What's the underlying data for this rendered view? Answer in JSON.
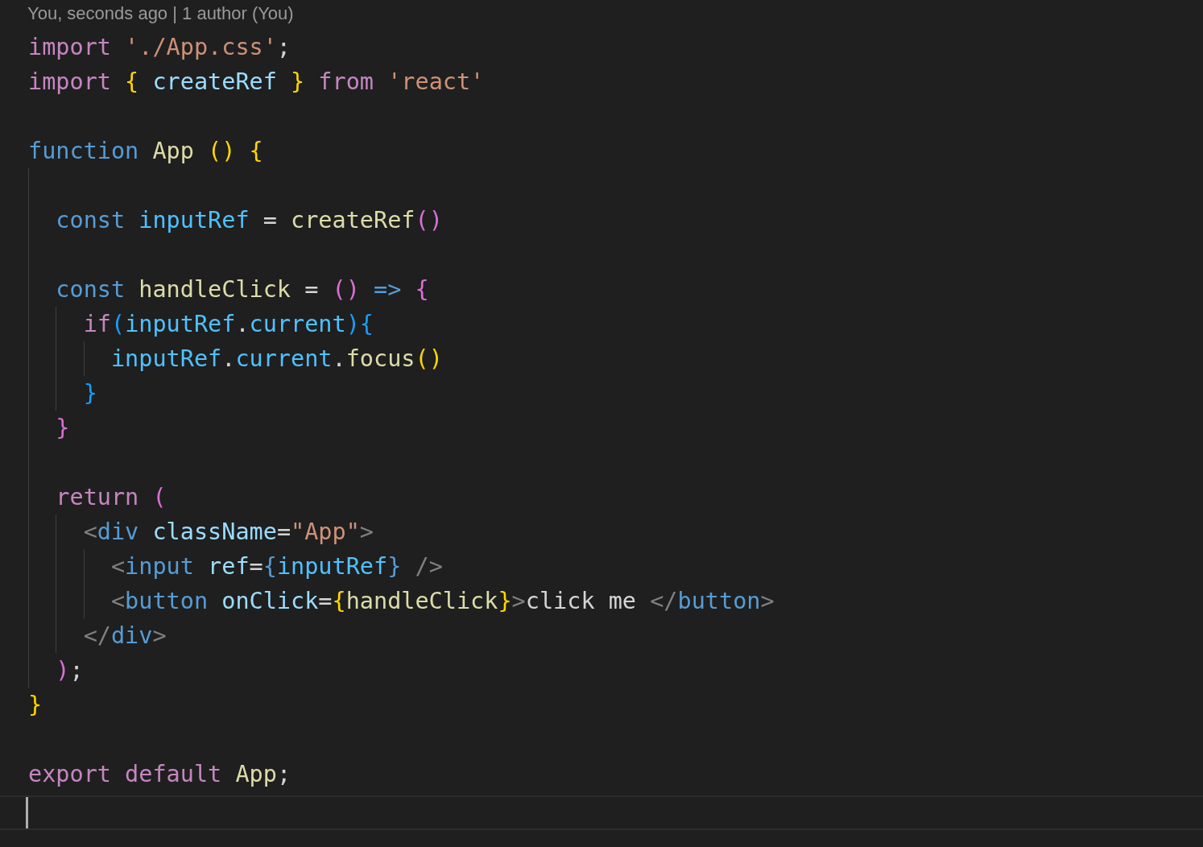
{
  "blame_header": "You, seconds ago | 1 author (You)",
  "lines": [
    {
      "kind": "code",
      "tokens": [
        {
          "text": "import ",
          "kind": "keyword"
        },
        {
          "text": "'./App.css'",
          "kind": "string"
        },
        {
          "text": ";",
          "kind": "plain"
        }
      ]
    },
    {
      "kind": "code",
      "tokens": [
        {
          "text": "import ",
          "kind": "keyword"
        },
        {
          "text": "{",
          "kind": "b1"
        },
        {
          "text": " createRef ",
          "kind": "var"
        },
        {
          "text": "} ",
          "kind": "b1"
        },
        {
          "text": "from ",
          "kind": "keyword"
        },
        {
          "text": "'react'",
          "kind": "string"
        }
      ]
    },
    {
      "kind": "blank"
    },
    {
      "kind": "code",
      "tokens": [
        {
          "text": "function ",
          "kind": "storage"
        },
        {
          "text": "App ",
          "kind": "func"
        },
        {
          "text": "() {",
          "kind": "b1"
        }
      ]
    },
    {
      "kind": "blank"
    },
    {
      "kind": "code",
      "tokens": [
        {
          "text": "  const ",
          "kind": "storage"
        },
        {
          "text": "inputRef",
          "kind": "const"
        },
        {
          "text": " = ",
          "kind": "plain"
        },
        {
          "text": "createRef",
          "kind": "func"
        },
        {
          "text": "()",
          "kind": "b2"
        }
      ]
    },
    {
      "kind": "blank"
    },
    {
      "kind": "code",
      "tokens": [
        {
          "text": "  const ",
          "kind": "storage"
        },
        {
          "text": "handleClick",
          "kind": "func"
        },
        {
          "text": " = ",
          "kind": "plain"
        },
        {
          "text": "() ",
          "kind": "b2"
        },
        {
          "text": "=> ",
          "kind": "storage"
        },
        {
          "text": "{",
          "kind": "b2"
        }
      ]
    },
    {
      "kind": "code",
      "tokens": [
        {
          "text": "    if",
          "kind": "keyword"
        },
        {
          "text": "(",
          "kind": "b3"
        },
        {
          "text": "inputRef",
          "kind": "const"
        },
        {
          "text": ".",
          "kind": "plain"
        },
        {
          "text": "current",
          "kind": "const"
        },
        {
          "text": "){",
          "kind": "b3"
        }
      ]
    },
    {
      "kind": "code",
      "tokens": [
        {
          "text": "      inputRef",
          "kind": "const"
        },
        {
          "text": ".",
          "kind": "plain"
        },
        {
          "text": "current",
          "kind": "const"
        },
        {
          "text": ".",
          "kind": "plain"
        },
        {
          "text": "focus",
          "kind": "func"
        },
        {
          "text": "()",
          "kind": "b1"
        }
      ]
    },
    {
      "kind": "code",
      "tokens": [
        {
          "text": "    }",
          "kind": "b3"
        }
      ]
    },
    {
      "kind": "code",
      "tokens": [
        {
          "text": "  }",
          "kind": "b2"
        }
      ]
    },
    {
      "kind": "blank"
    },
    {
      "kind": "code",
      "tokens": [
        {
          "text": "  return ",
          "kind": "keyword"
        },
        {
          "text": "(",
          "kind": "b2"
        }
      ]
    },
    {
      "kind": "code",
      "tokens": [
        {
          "text": "    <",
          "kind": "tagp"
        },
        {
          "text": "div ",
          "kind": "tag"
        },
        {
          "text": "className",
          "kind": "var"
        },
        {
          "text": "=",
          "kind": "plain"
        },
        {
          "text": "\"App\"",
          "kind": "string"
        },
        {
          "text": ">",
          "kind": "tagp"
        }
      ]
    },
    {
      "kind": "code",
      "tokens": [
        {
          "text": "      <",
          "kind": "tagp"
        },
        {
          "text": "input ",
          "kind": "tag"
        },
        {
          "text": "ref",
          "kind": "var"
        },
        {
          "text": "=",
          "kind": "plain"
        },
        {
          "text": "{",
          "kind": "tag"
        },
        {
          "text": "inputRef",
          "kind": "const"
        },
        {
          "text": "} ",
          "kind": "tag"
        },
        {
          "text": "/>",
          "kind": "tagp"
        }
      ]
    },
    {
      "kind": "code",
      "tokens": [
        {
          "text": "      <",
          "kind": "tagp"
        },
        {
          "text": "button ",
          "kind": "tag"
        },
        {
          "text": "onClick",
          "kind": "var"
        },
        {
          "text": "=",
          "kind": "plain"
        },
        {
          "text": "{",
          "kind": "b1"
        },
        {
          "text": "handleClick",
          "kind": "func"
        },
        {
          "text": "}",
          "kind": "b1"
        },
        {
          "text": ">",
          "kind": "tagp"
        },
        {
          "text": "click me ",
          "kind": "plain"
        },
        {
          "text": "</",
          "kind": "tagp"
        },
        {
          "text": "button",
          "kind": "tag"
        },
        {
          "text": ">",
          "kind": "tagp"
        }
      ]
    },
    {
      "kind": "code",
      "tokens": [
        {
          "text": "    </",
          "kind": "tagp"
        },
        {
          "text": "div",
          "kind": "tag"
        },
        {
          "text": ">",
          "kind": "tagp"
        }
      ]
    },
    {
      "kind": "code",
      "tokens": [
        {
          "text": "  )",
          "kind": "b2"
        },
        {
          "text": ";",
          "kind": "plain"
        }
      ]
    },
    {
      "kind": "code",
      "tokens": [
        {
          "text": "}",
          "kind": "b1"
        }
      ]
    },
    {
      "kind": "blank"
    },
    {
      "kind": "code",
      "tokens": [
        {
          "text": "export default ",
          "kind": "keyword"
        },
        {
          "text": "App",
          "kind": "func"
        },
        {
          "text": ";",
          "kind": "plain"
        }
      ]
    },
    {
      "kind": "cursor"
    }
  ]
}
